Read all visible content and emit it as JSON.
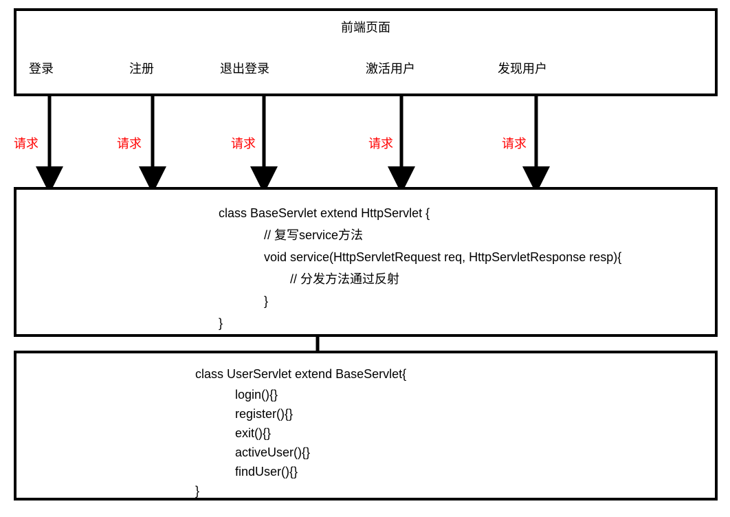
{
  "topBox": {
    "title": "前端页面",
    "items": [
      "登录",
      "注册",
      "退出登录",
      "激活用户",
      "发现用户"
    ]
  },
  "arrows": {
    "label": "请求"
  },
  "middleBox": {
    "lines": [
      "class BaseServlet extend HttpServlet {",
      "// 复写service方法",
      "void service(HttpServletRequest req, HttpServletResponse resp){",
      "// 分发方法通过反射",
      "}",
      "}"
    ]
  },
  "bottomBox": {
    "lines": [
      "class UserServlet extend BaseServlet{",
      "login(){}",
      "register(){}",
      "exit(){}",
      "activeUser(){}",
      "findUser(){}",
      "}"
    ]
  }
}
